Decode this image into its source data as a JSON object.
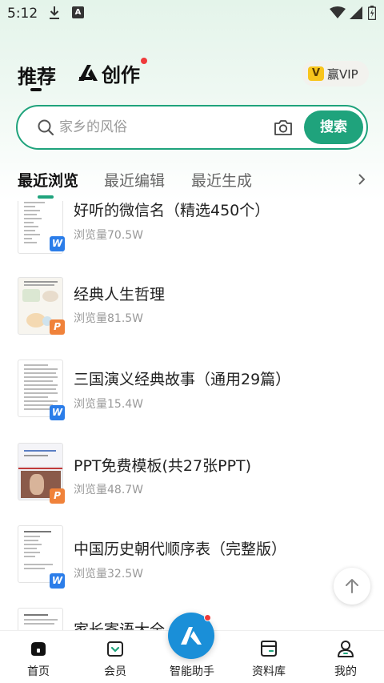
{
  "status_bar": {
    "time": "5:12"
  },
  "header": {
    "tab_recommend": "推荐",
    "tab_create": "创作",
    "vip_label": "赢VIP"
  },
  "search": {
    "placeholder": "家乡的风俗",
    "button_label": "搜索"
  },
  "sub_tabs": {
    "items": [
      "最近浏览",
      "最近编辑",
      "最近生成"
    ],
    "active": "最近浏览"
  },
  "documents": [
    {
      "title": "好听的微信名（精选450个）",
      "views": "浏览量70.5W",
      "type": "W"
    },
    {
      "title": "经典人生哲理",
      "views": "浏览量81.5W",
      "type": "P"
    },
    {
      "title": "三国演义经典故事（通用29篇）",
      "views": "浏览量15.4W",
      "type": "W"
    },
    {
      "title": "PPT免费模板(共27张PPT)",
      "views": "浏览量48.7W",
      "type": "P"
    },
    {
      "title": "中国历史朝代顺序表（完整版）",
      "views": "浏览量32.5W",
      "type": "W"
    },
    {
      "title": "家长寄语大全",
      "views": "",
      "type": "W"
    }
  ],
  "bottom_nav": {
    "items": [
      "首页",
      "会员",
      "智能助手",
      "资料库",
      "我的"
    ]
  },
  "colors": {
    "accent": "#1fa37c",
    "word_badge": "#2b7de9",
    "ppt_badge": "#f0823a",
    "assistant": "#1a8fd8"
  },
  "icons": [
    "download-icon",
    "a-notification-icon",
    "wifi-icon",
    "signal-icon",
    "battery-icon",
    "search-icon",
    "camera-icon",
    "chevron-right-icon",
    "arrow-up-icon",
    "home-icon",
    "member-icon",
    "assistant-icon",
    "library-icon",
    "profile-icon"
  ]
}
